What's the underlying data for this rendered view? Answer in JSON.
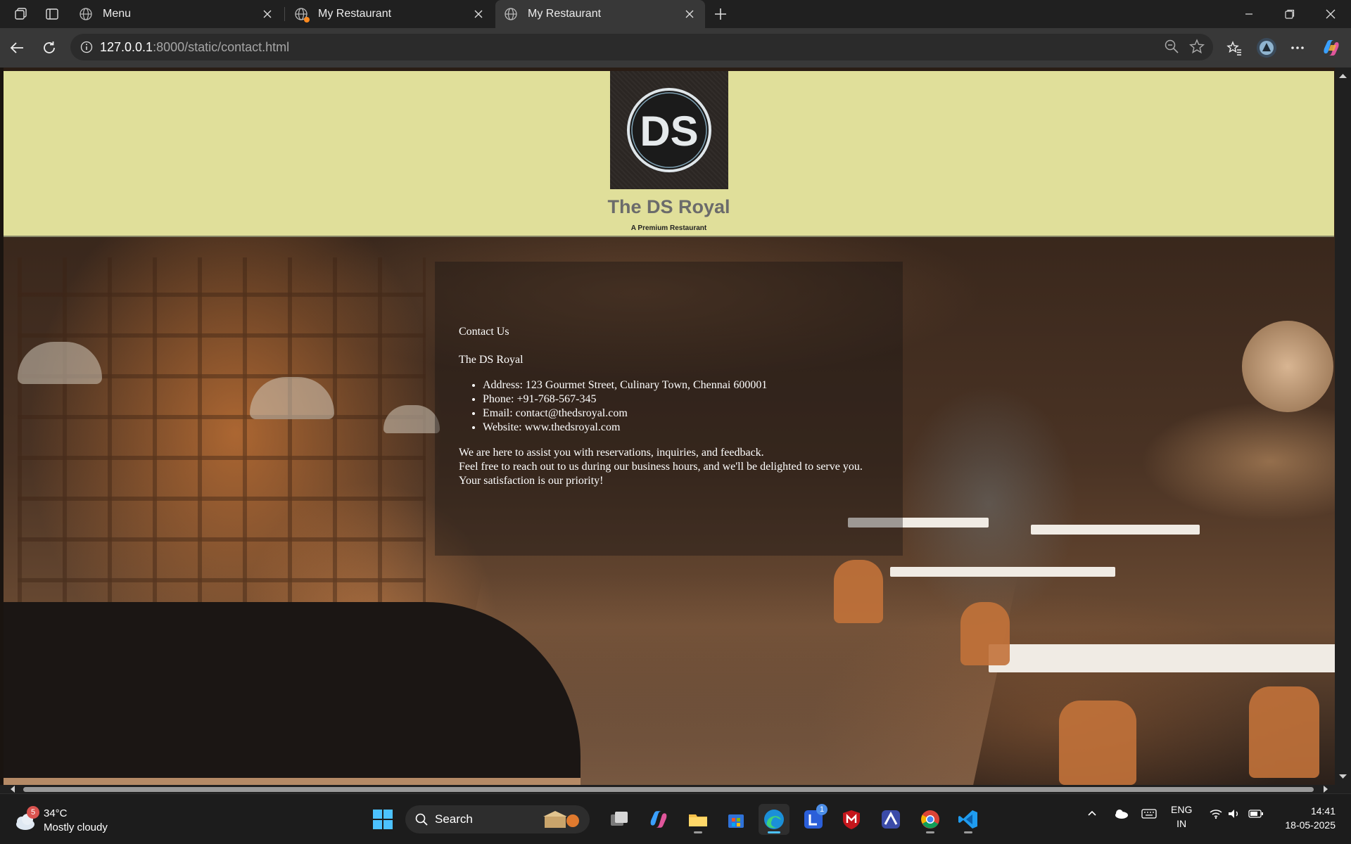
{
  "browser": {
    "tabs": [
      {
        "title": "Menu"
      },
      {
        "title": "My Restaurant"
      },
      {
        "title": "My Restaurant"
      }
    ],
    "address": {
      "host": "127.0.0.1",
      "path": ":8000/static/contact.html"
    }
  },
  "page": {
    "brand_name": "The DS Royal",
    "tagline": "A Premium Restaurant",
    "logo_text": "DS",
    "contact": {
      "heading": "Contact Us",
      "name": "The DS Royal",
      "items": [
        "Address: 123 Gourmet Street, Culinary Town, Chennai 600001",
        "Phone: +91-768-567-345",
        "Email: contact@thedsroyal.com",
        "Website: www.thedsroyal.com"
      ],
      "message": [
        "We are here to assist you with reservations, inquiries, and feedback.",
        "Feel free to reach out to us during our business hours, and we'll be delighted to serve you.",
        "Your satisfaction is our priority!"
      ]
    },
    "colors": {
      "header_bg": "#e0df9a",
      "brand": "#6b6b6b"
    }
  },
  "taskbar": {
    "weather": {
      "temp": "34°C",
      "condition": "Mostly cloudy",
      "badge": "5"
    },
    "search_label": "Search",
    "notif_badge": "1",
    "language": [
      "ENG",
      "IN"
    ],
    "time": "14:41",
    "date": "18-05-2025"
  }
}
